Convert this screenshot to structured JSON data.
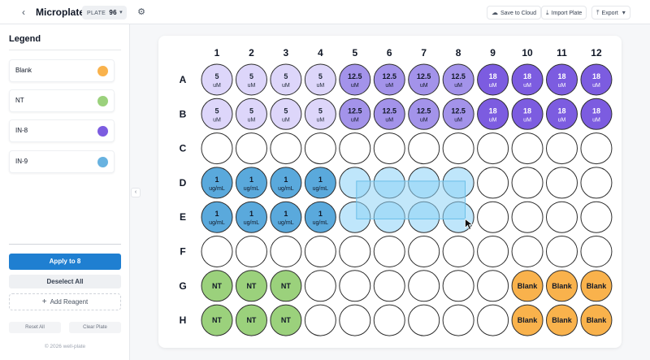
{
  "header": {
    "back_icon": "chevron-left-icon",
    "title": "Microplate",
    "plate_prefix": "PLATE",
    "plate_size": "96",
    "settings_icon": "gear-icon",
    "save_label": "Save to Cloud",
    "import_label": "Import Plate",
    "export_label": "Export"
  },
  "sidebar": {
    "legend_title": "Legend",
    "legend": [
      {
        "label": "Blank",
        "color": "#f9b24c"
      },
      {
        "label": "NT",
        "color": "#9bd17c"
      },
      {
        "label": "IN-8",
        "color": "#7c5ce0"
      },
      {
        "label": "IN-9",
        "color": "#68b2e0"
      }
    ],
    "apply_label": "Apply to 8",
    "deselect_label": "Deselect All",
    "add_reagent_label": "Add Reagent",
    "reset_label": "Reset All",
    "clear_label": "Clear Plate",
    "footer": "© 2026 well-plate"
  },
  "plate": {
    "columns": [
      "1",
      "2",
      "3",
      "4",
      "5",
      "6",
      "7",
      "8",
      "9",
      "10",
      "11",
      "12"
    ],
    "rows": [
      "A",
      "B",
      "C",
      "D",
      "E",
      "F",
      "G",
      "H"
    ],
    "reagents": {
      "c5": {
        "fill": "#ddd6fa",
        "stroke": "#2d2d2d",
        "text": "#1f2937"
      },
      "c125": {
        "fill": "#a393ea",
        "stroke": "#2d2d2d",
        "text": "#111827"
      },
      "c18": {
        "fill": "#7c5ce0",
        "stroke": "#2d2d2d",
        "text": "#ffffff"
      },
      "in9": {
        "fill": "#5aa9dc",
        "stroke": "#2d2d2d",
        "text": "#111827"
      },
      "nt": {
        "fill": "#9bd17c",
        "stroke": "#2d2d2d",
        "text": "#111827"
      },
      "blank": {
        "fill": "#f9b24c",
        "stroke": "#2d2d2d",
        "text": "#111827"
      },
      "sel": {
        "fill": "#bfe6fb",
        "stroke": "#2d2d2d",
        "text": "#111827"
      },
      "empty": {
        "fill": "#ffffff",
        "stroke": "#2d2d2d",
        "text": "#111827"
      }
    },
    "wells": [
      [
        "A",
        1,
        "c5",
        "5",
        "uM"
      ],
      [
        "A",
        2,
        "c5",
        "5",
        "uM"
      ],
      [
        "A",
        3,
        "c5",
        "5",
        "uM"
      ],
      [
        "A",
        4,
        "c5",
        "5",
        "uM"
      ],
      [
        "A",
        5,
        "c125",
        "12.5",
        "uM"
      ],
      [
        "A",
        6,
        "c125",
        "12.5",
        "uM"
      ],
      [
        "A",
        7,
        "c125",
        "12.5",
        "uM"
      ],
      [
        "A",
        8,
        "c125",
        "12.5",
        "uM"
      ],
      [
        "A",
        9,
        "c18",
        "18",
        "uM"
      ],
      [
        "A",
        10,
        "c18",
        "18",
        "uM"
      ],
      [
        "A",
        11,
        "c18",
        "18",
        "uM"
      ],
      [
        "A",
        12,
        "c18",
        "18",
        "uM"
      ],
      [
        "B",
        1,
        "c5",
        "5",
        "uM"
      ],
      [
        "B",
        2,
        "c5",
        "5",
        "uM"
      ],
      [
        "B",
        3,
        "c5",
        "5",
        "uM"
      ],
      [
        "B",
        4,
        "c5",
        "5",
        "uM"
      ],
      [
        "B",
        5,
        "c125",
        "12.5",
        "uM"
      ],
      [
        "B",
        6,
        "c125",
        "12.5",
        "uM"
      ],
      [
        "B",
        7,
        "c125",
        "12.5",
        "uM"
      ],
      [
        "B",
        8,
        "c125",
        "12.5",
        "uM"
      ],
      [
        "B",
        9,
        "c18",
        "18",
        "uM"
      ],
      [
        "B",
        10,
        "c18",
        "18",
        "uM"
      ],
      [
        "B",
        11,
        "c18",
        "18",
        "uM"
      ],
      [
        "B",
        12,
        "c18",
        "18",
        "uM"
      ],
      [
        "D",
        1,
        "in9",
        "1",
        "ug/mL"
      ],
      [
        "D",
        2,
        "in9",
        "1",
        "ug/mL"
      ],
      [
        "D",
        3,
        "in9",
        "1",
        "ug/mL"
      ],
      [
        "D",
        4,
        "in9",
        "1",
        "ug/mL"
      ],
      [
        "D",
        5,
        "sel",
        "",
        ""
      ],
      [
        "D",
        6,
        "sel",
        "",
        ""
      ],
      [
        "D",
        7,
        "sel",
        "",
        ""
      ],
      [
        "D",
        8,
        "sel",
        "",
        ""
      ],
      [
        "E",
        1,
        "in9",
        "1",
        "ug/mL"
      ],
      [
        "E",
        2,
        "in9",
        "1",
        "ug/mL"
      ],
      [
        "E",
        3,
        "in9",
        "1",
        "ug/mL"
      ],
      [
        "E",
        4,
        "in9",
        "1",
        "ug/mL"
      ],
      [
        "E",
        5,
        "sel",
        "",
        ""
      ],
      [
        "E",
        6,
        "sel",
        "",
        ""
      ],
      [
        "E",
        7,
        "sel",
        "",
        ""
      ],
      [
        "E",
        8,
        "sel",
        "",
        ""
      ],
      [
        "G",
        1,
        "nt",
        "NT",
        ""
      ],
      [
        "G",
        2,
        "nt",
        "NT",
        ""
      ],
      [
        "G",
        3,
        "nt",
        "NT",
        ""
      ],
      [
        "G",
        10,
        "blank",
        "Blank",
        ""
      ],
      [
        "G",
        11,
        "blank",
        "Blank",
        ""
      ],
      [
        "G",
        12,
        "blank",
        "Blank",
        ""
      ],
      [
        "H",
        1,
        "nt",
        "NT",
        ""
      ],
      [
        "H",
        2,
        "nt",
        "NT",
        ""
      ],
      [
        "H",
        3,
        "nt",
        "NT",
        ""
      ],
      [
        "H",
        10,
        "blank",
        "Blank",
        ""
      ],
      [
        "H",
        11,
        "blank",
        "Blank",
        ""
      ],
      [
        "H",
        12,
        "blank",
        "Blank",
        ""
      ]
    ],
    "selection": {
      "from": [
        "D",
        5
      ],
      "to": [
        "E",
        8
      ]
    },
    "selection_color": "#8fd3f5"
  }
}
